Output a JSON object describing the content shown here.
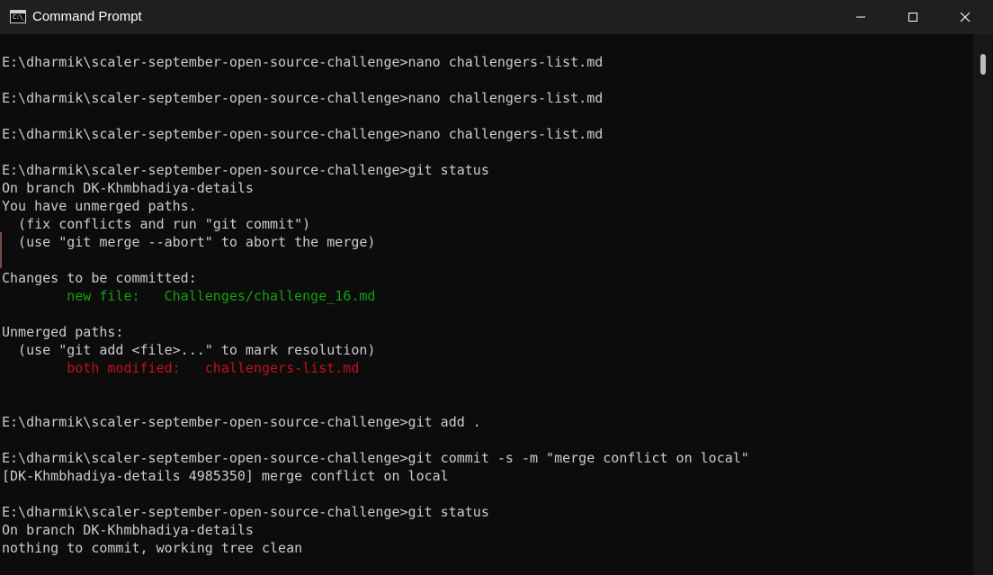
{
  "window": {
    "title": "Command Prompt",
    "icon": "cmd-icon",
    "icon_text": "C:\\_",
    "buttons": [
      "minimize-icon",
      "maximize-icon",
      "close-icon"
    ]
  },
  "terminal": {
    "lines": [
      {
        "text": "E:\\dharmik\\scaler-september-open-source-challenge>nano challengers-list.md"
      },
      {
        "text": ""
      },
      {
        "text": "E:\\dharmik\\scaler-september-open-source-challenge>nano challengers-list.md"
      },
      {
        "text": ""
      },
      {
        "text": "E:\\dharmik\\scaler-september-open-source-challenge>nano challengers-list.md"
      },
      {
        "text": ""
      },
      {
        "text": "E:\\dharmik\\scaler-september-open-source-challenge>git status"
      },
      {
        "text": "On branch DK-Khmbhadiya-details"
      },
      {
        "text": "You have unmerged paths."
      },
      {
        "text": "  (fix conflicts and run \"git commit\")"
      },
      {
        "text": "  (use \"git merge --abort\" to abort the merge)"
      },
      {
        "text": ""
      },
      {
        "text": "Changes to be committed:"
      },
      {
        "indent": "        ",
        "text": "new file:   Challenges/challenge_16.md",
        "color": "#13a10e"
      },
      {
        "text": ""
      },
      {
        "text": "Unmerged paths:"
      },
      {
        "text": "  (use \"git add <file>...\" to mark resolution)"
      },
      {
        "indent": "        ",
        "text": "both modified:   challengers-list.md",
        "color": "#c50f1f"
      },
      {
        "text": ""
      },
      {
        "text": ""
      },
      {
        "text": "E:\\dharmik\\scaler-september-open-source-challenge>git add ."
      },
      {
        "text": ""
      },
      {
        "text": "E:\\dharmik\\scaler-september-open-source-challenge>git commit -s -m \"merge conflict on local\""
      },
      {
        "text": "[DK-Khmbhadiya-details 4985350] merge conflict on local"
      },
      {
        "text": ""
      },
      {
        "text": "E:\\dharmik\\scaler-september-open-source-challenge>git status"
      },
      {
        "text": "On branch DK-Khmbhadiya-details"
      },
      {
        "text": "nothing to commit, working tree clean"
      }
    ]
  },
  "colors": {
    "background": "#0c0c0c",
    "titlebar": "#1f1f1f",
    "text": "#cccccc",
    "green": "#13a10e",
    "red": "#c50f1f"
  }
}
